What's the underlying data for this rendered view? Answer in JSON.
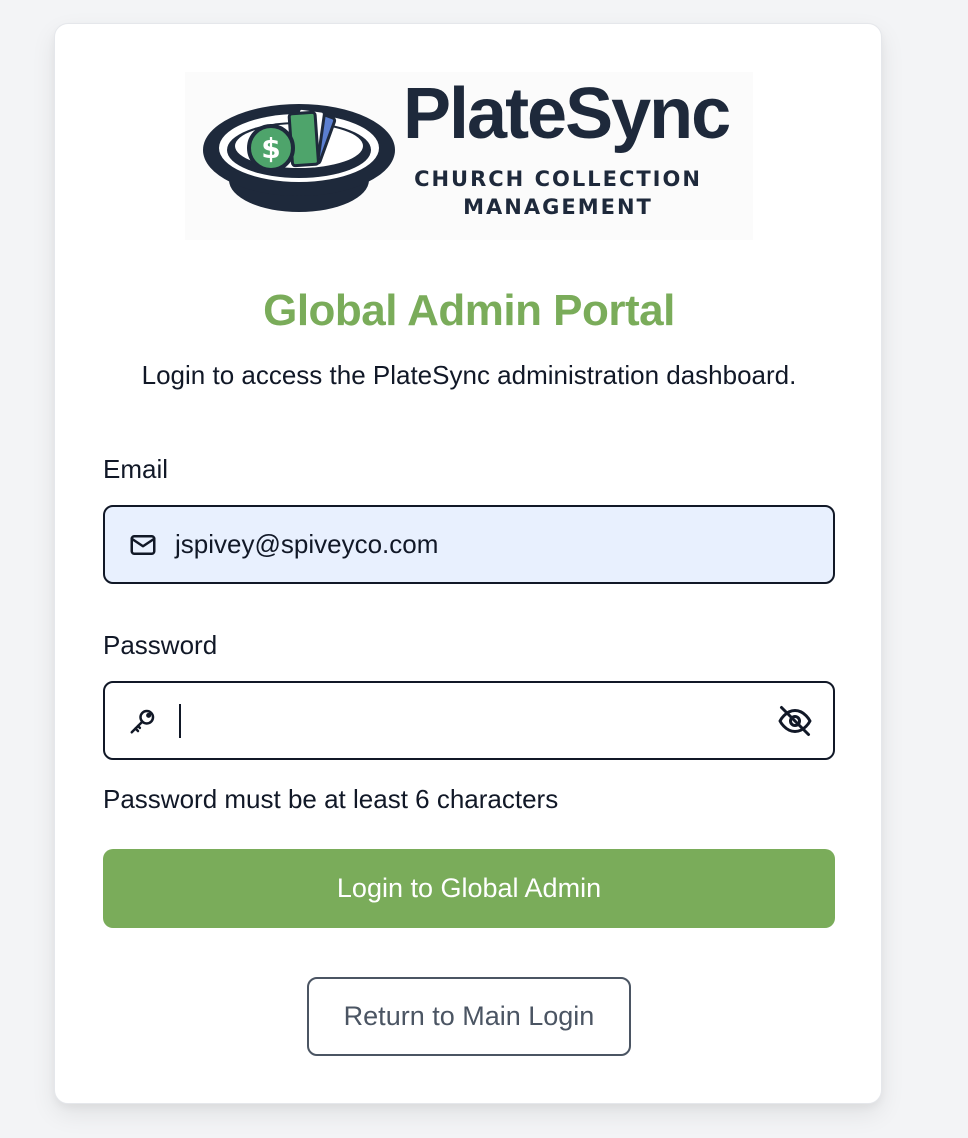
{
  "brand": {
    "name": "PlateSync",
    "tagline_line1": "CHURCH COLLECTION",
    "tagline_line2": "MANAGEMENT"
  },
  "colors": {
    "accent": "#7aac5a",
    "navy": "#1e293b",
    "input_autofill_bg": "#e8f0fe"
  },
  "header": {
    "title": "Global Admin Portal",
    "subtitle": "Login to access the PlateSync administration dashboard."
  },
  "form": {
    "email_label": "Email",
    "email_value": "jspivey@spiveyco.com",
    "email_icon": "mail-icon",
    "password_label": "Password",
    "password_value": "",
    "password_icon": "key-icon",
    "password_toggle_icon": "eye-off-icon",
    "password_hint": "Password must be at least 6 characters",
    "submit_label": "Login to Global Admin",
    "return_label": "Return to Main Login"
  }
}
